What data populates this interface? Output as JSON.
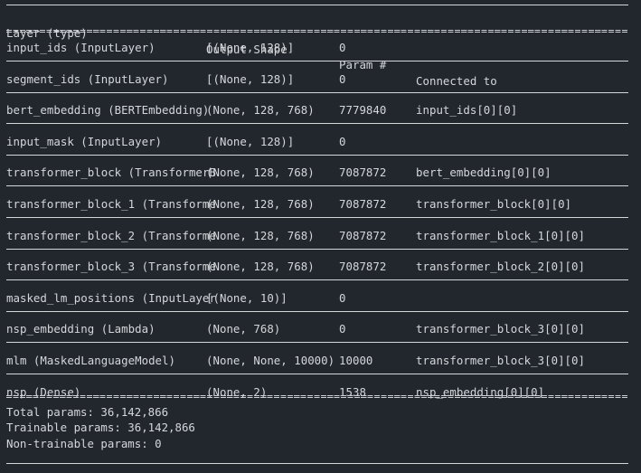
{
  "terminal": {
    "background_color": "#22272e",
    "text_color": "#d4d7da"
  },
  "summary": {
    "columns": [
      "Layer (type)",
      "Output Shape",
      "Param #",
      "Connected to"
    ],
    "rows": [
      {
        "name": "input_ids (InputLayer)",
        "shape": "[(None, 128)]",
        "params": "0",
        "connected": ""
      },
      {
        "name": "segment_ids (InputLayer)",
        "shape": "[(None, 128)]",
        "params": "0",
        "connected": ""
      },
      {
        "name": "bert_embedding (BERTEmbedding)",
        "shape": "(None, 128, 768)",
        "params": "7779840",
        "connected": "input_ids[0][0]"
      },
      {
        "name": "input_mask (InputLayer)",
        "shape": "[(None, 128)]",
        "params": "0",
        "connected": ""
      },
      {
        "name": "transformer_block (TransformerB",
        "shape": "(None, 128, 768)",
        "params": "7087872",
        "connected": "bert_embedding[0][0]"
      },
      {
        "name": "transformer_block_1 (Transforme",
        "shape": "(None, 128, 768)",
        "params": "7087872",
        "connected": "transformer_block[0][0]"
      },
      {
        "name": "transformer_block_2 (Transforme",
        "shape": "(None, 128, 768)",
        "params": "7087872",
        "connected": "transformer_block_1[0][0]"
      },
      {
        "name": "transformer_block_3 (Transforme",
        "shape": "(None, 128, 768)",
        "params": "7087872",
        "connected": "transformer_block_2[0][0]"
      },
      {
        "name": "masked_lm_positions (InputLayer",
        "shape": "[(None, 10)]",
        "params": "0",
        "connected": ""
      },
      {
        "name": "nsp_embedding (Lambda)",
        "shape": "(None, 768)",
        "params": "0",
        "connected": "transformer_block_3[0][0]"
      },
      {
        "name": "mlm (MaskedLanguageModel)",
        "shape": "(None, None, 10000)",
        "params": "10000",
        "connected": "transformer_block_3[0][0]"
      },
      {
        "name": "nsp (Dense)",
        "shape": "(None, 2)",
        "params": "1538",
        "connected": "nsp_embedding[0][0]"
      }
    ],
    "totals": [
      "Total params: 36,142,866",
      "Trainable params: 36,142,866",
      "Non-trainable params: 0"
    ]
  }
}
